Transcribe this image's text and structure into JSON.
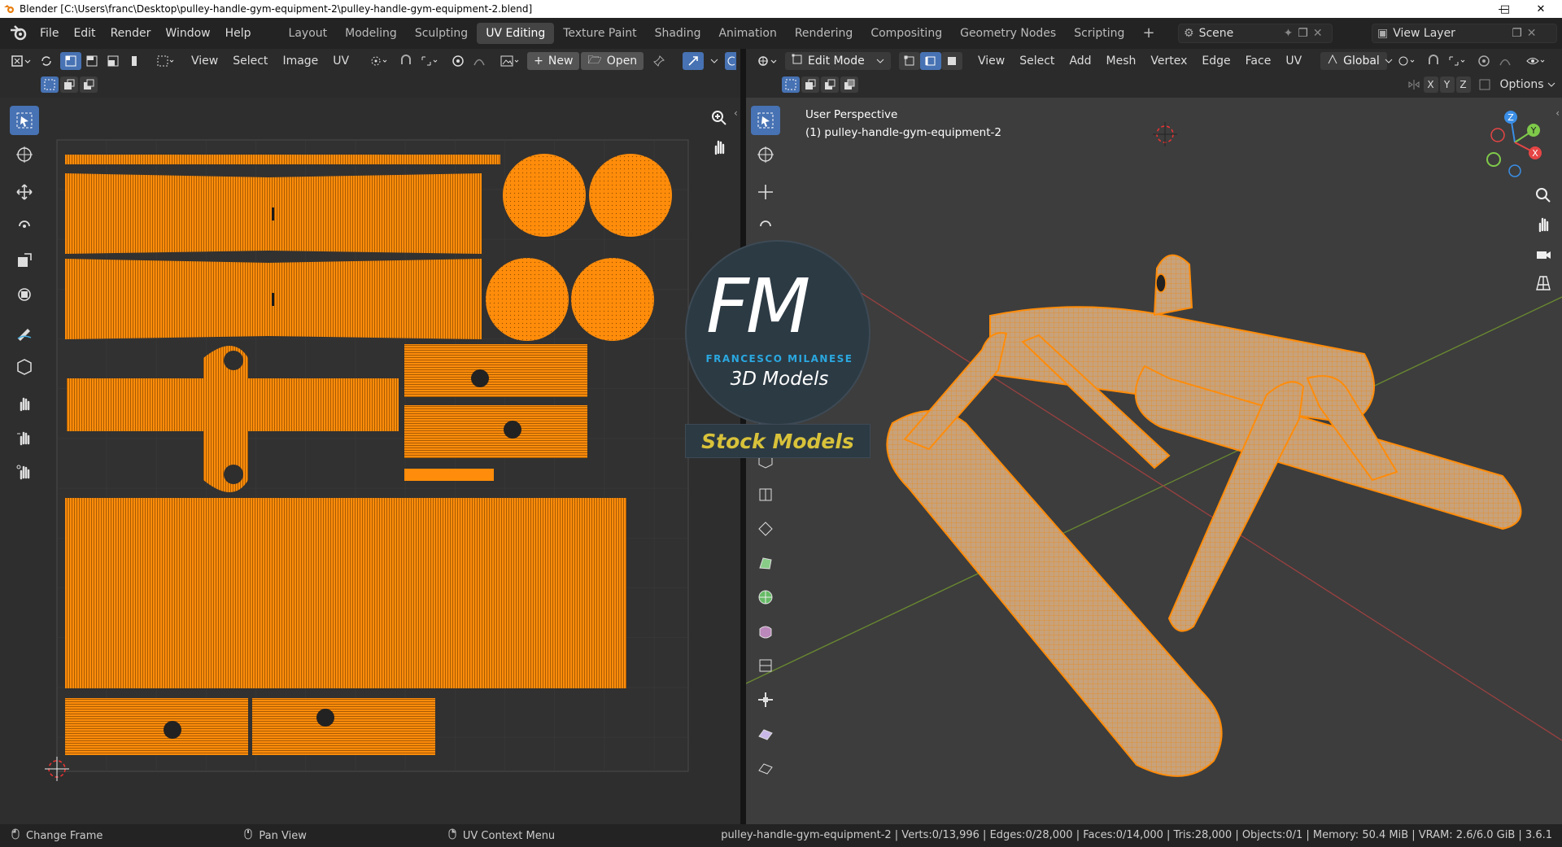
{
  "window": {
    "title": "Blender [C:\\Users\\franc\\Desktop\\pulley-handle-gym-equipment-2\\pulley-handle-gym-equipment-2.blend]"
  },
  "menus": {
    "file": "File",
    "edit": "Edit",
    "render": "Render",
    "window": "Window",
    "help": "Help"
  },
  "workspaces": [
    "Layout",
    "Modeling",
    "Sculpting",
    "UV Editing",
    "Texture Paint",
    "Shading",
    "Animation",
    "Rendering",
    "Compositing",
    "Geometry Nodes",
    "Scripting"
  ],
  "active_workspace": "UV Editing",
  "scene": {
    "name": "Scene",
    "view_layer": "View Layer"
  },
  "uv_editor": {
    "menus": [
      "View",
      "Select",
      "Image",
      "UV"
    ],
    "new_label": "New",
    "open_label": "Open"
  },
  "viewport": {
    "mode": "Edit Mode",
    "menus": [
      "View",
      "Select",
      "Add",
      "Mesh",
      "Vertex",
      "Edge",
      "Face",
      "UV"
    ],
    "orientation": "Global",
    "options_label": "Options",
    "axes": [
      "X",
      "Y",
      "Z"
    ],
    "perspective": "User Perspective",
    "object_label": "(1) pulley-handle-gym-equipment-2"
  },
  "watermark": {
    "initials": "FM",
    "name": "FRANCESCO MILANESE",
    "subtitle": "3D Models",
    "banner": "Stock Models"
  },
  "statusbar": {
    "change_frame": "Change Frame",
    "pan_view": "Pan View",
    "uv_context": "UV Context Menu",
    "stats": "pulley-handle-gym-equipment-2 | Verts:0/13,996 | Edges:0/28,000 | Faces:0/14,000 | Tris:28,000 | Objects:0/1 | Memory: 50.4 MiB | VRAM: 2.6/6.0 GiB | 3.6.1"
  },
  "colors": {
    "accent": "#4772b3",
    "uv_orange": "#ff8c0a",
    "mesh_orange": "#e8a25a"
  }
}
